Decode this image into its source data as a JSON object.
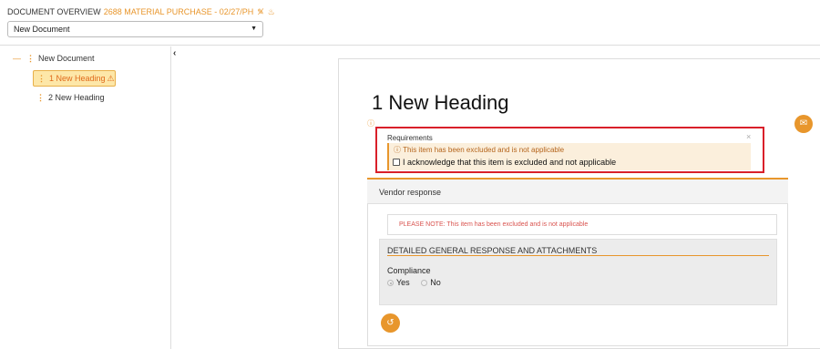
{
  "header": {
    "title": "DOCUMENT OVERVIEW",
    "document_name": "2688 MATERIAL PURCHASE - 02/27/PH",
    "icons": [
      "pencil-cross-icon",
      "flame-icon"
    ],
    "document_select_value": "New Document"
  },
  "tree": {
    "root_label": "New Document",
    "items": [
      {
        "label": "1 New Heading",
        "status": "warning"
      },
      {
        "label": "2 New Heading"
      }
    ]
  },
  "content": {
    "heading": "1 New Heading",
    "requirements": {
      "title": "Requirements",
      "note": "This item has been excluded and is not applicable",
      "acknowledge_label": "I acknowledge that this item is excluded and not applicable",
      "acknowledged": false
    },
    "vendor": {
      "label": "Vendor response",
      "notice": "PLEASE NOTE: This item has been excluded and is not applicable",
      "section_title": "DETAILED GENERAL RESPONSE AND ATTACHMENTS",
      "compliance_label": "Compliance",
      "options": [
        "Yes",
        "No"
      ],
      "selected": "Yes"
    }
  },
  "colors": {
    "accent": "#e8962c",
    "highlight_border": "#d9202a",
    "notice_text": "#d9534f"
  }
}
